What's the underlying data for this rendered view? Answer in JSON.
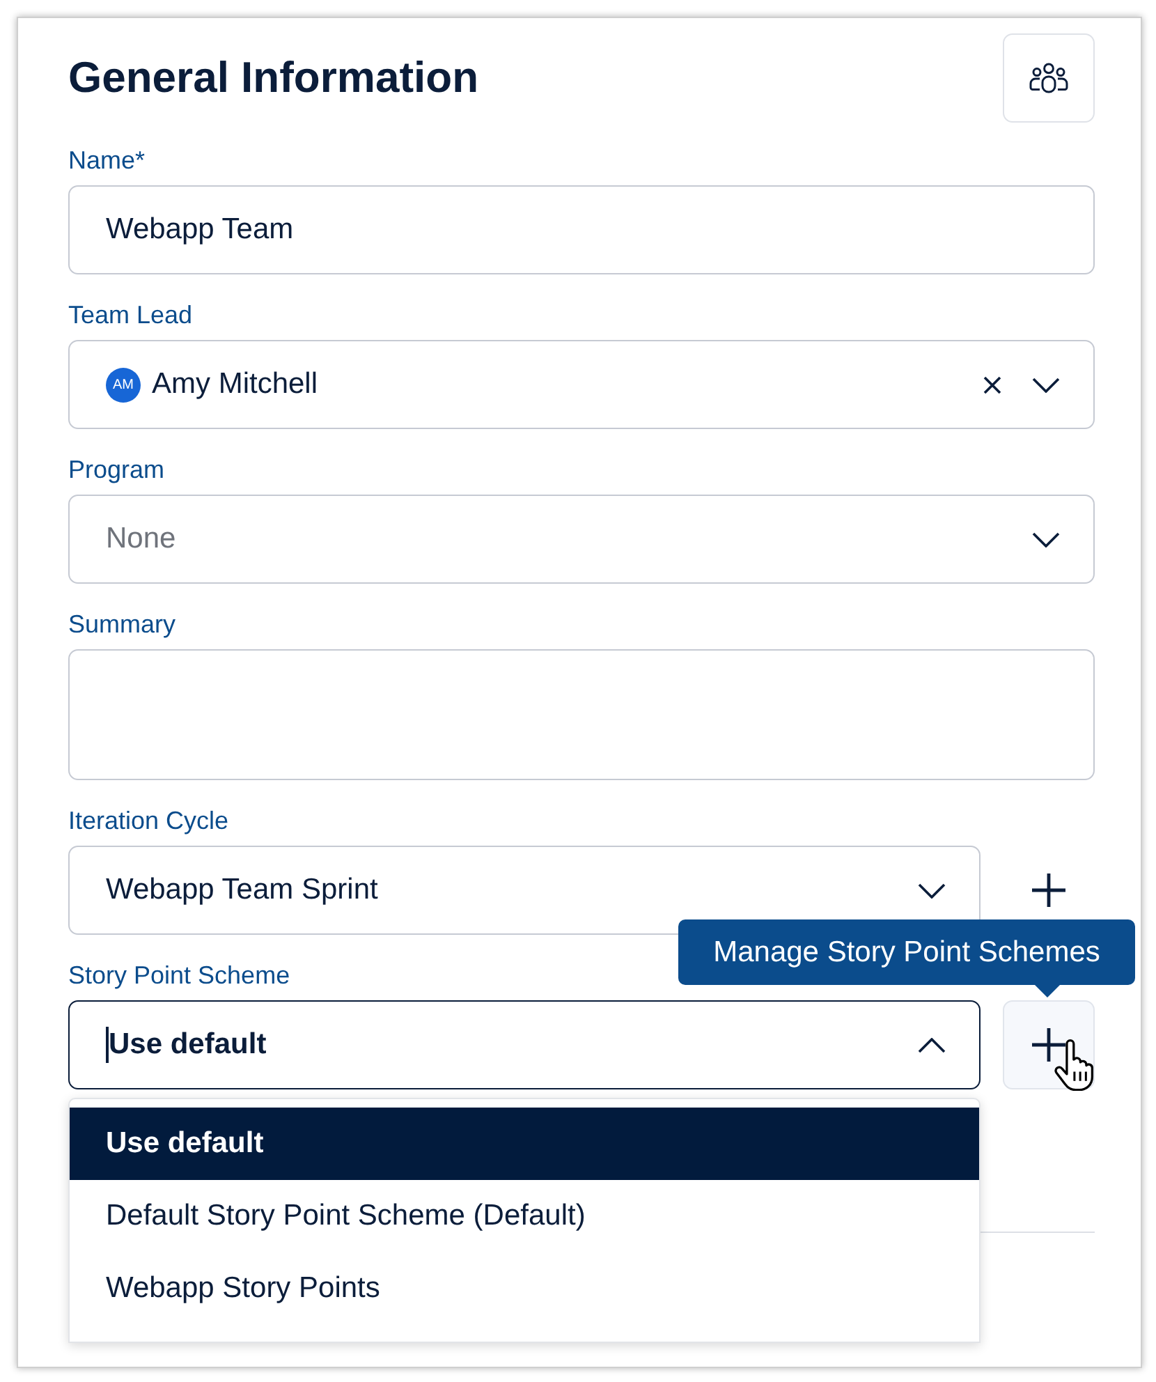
{
  "panel": {
    "title": "General Information"
  },
  "fields": [
    {
      "kind": "text",
      "label": "Name*",
      "value": "Webapp Team"
    },
    {
      "kind": "select",
      "label": "Team Lead",
      "value": "Amy Mitchell",
      "avatar": "AM",
      "clearable": true,
      "focused": false,
      "expanded": false
    },
    {
      "kind": "select",
      "label": "Program",
      "placeholder": "None",
      "focused": false,
      "expanded": false
    },
    {
      "kind": "textarea",
      "label": "Summary"
    },
    {
      "kind": "select",
      "label": "Iteration Cycle",
      "value": "Webapp Team Sprint",
      "focused": false,
      "expanded": false,
      "add_button": {
        "hovered": false
      }
    },
    {
      "kind": "select",
      "label": "Story Point Scheme",
      "value": "Use default",
      "focused": true,
      "expanded": true,
      "add_button": {
        "hovered": true,
        "tooltip": "Manage Story Point Schemes"
      },
      "options": [
        {
          "label": "Use default",
          "selected": true
        },
        {
          "label": "Default Story Point Scheme (Default)",
          "selected": false
        },
        {
          "label": "Webapp Story Points",
          "selected": false
        }
      ]
    }
  ]
}
